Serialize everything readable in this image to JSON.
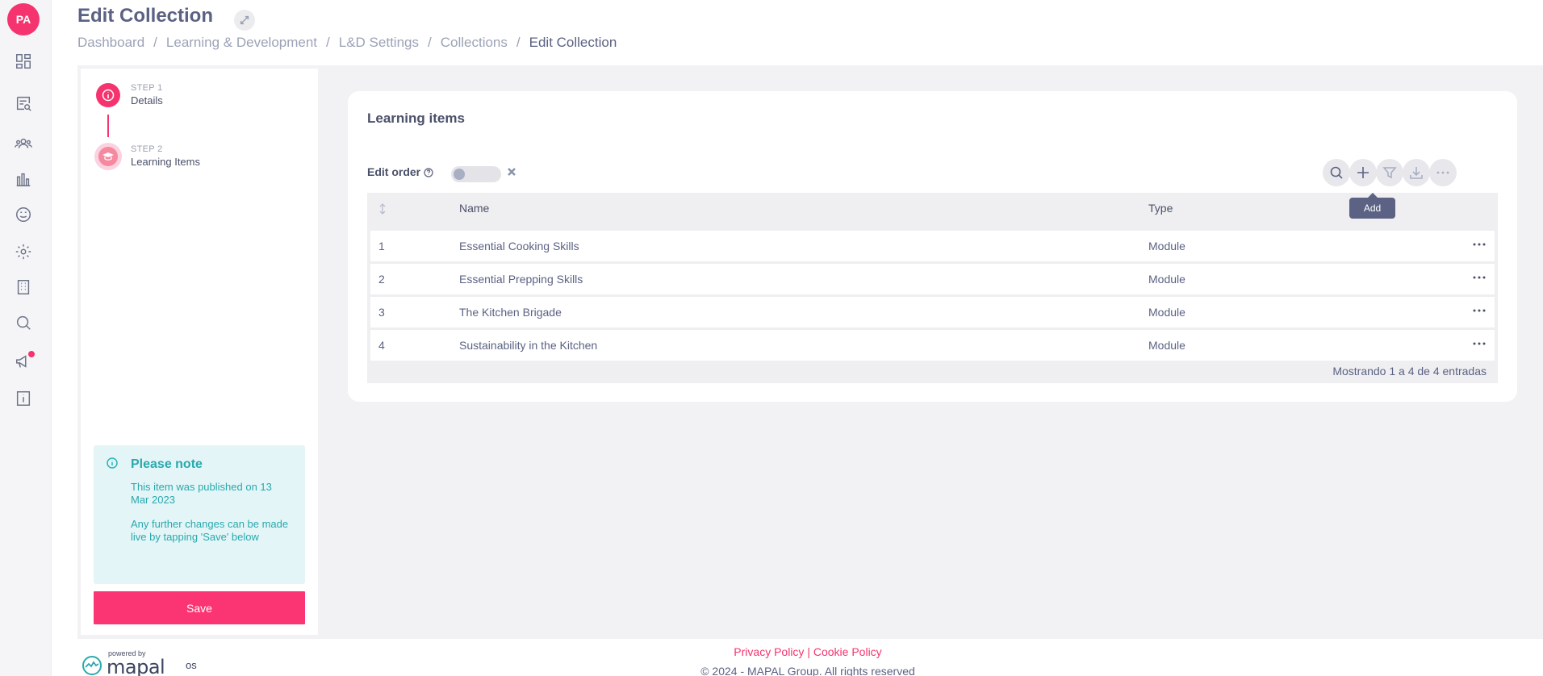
{
  "user": {
    "initials": "PA"
  },
  "rail": {
    "icons": [
      "dashboard-icon",
      "report-search-icon",
      "people-icon",
      "analytics-icon",
      "smiley-icon",
      "settings-icon",
      "building-icon",
      "search-icon",
      "megaphone-icon",
      "info-book-icon"
    ]
  },
  "header": {
    "title": "Edit Collection",
    "breadcrumb": [
      "Dashboard",
      "Learning & Development",
      "L&D Settings",
      "Collections",
      "Edit Collection"
    ],
    "separator": "/"
  },
  "stepper": {
    "steps": [
      {
        "number": "STEP 1",
        "label": "Details"
      },
      {
        "number": "STEP 2",
        "label": "Learning Items"
      }
    ],
    "note": {
      "title": "Please note",
      "line1": "This item was published on 13 Mar 2023",
      "line2": "Any further changes can be made live by tapping 'Save' below"
    },
    "save_label": "Save"
  },
  "card": {
    "title": "Learning items",
    "edit_order_label": "Edit order",
    "tooltip": "Add",
    "columns": {
      "sort": "↕",
      "name": "Name",
      "type": "Type"
    },
    "rows": [
      {
        "index": "1",
        "name": "Essential Cooking Skills",
        "type": "Module"
      },
      {
        "index": "2",
        "name": "Essential Prepping Skills",
        "type": "Module"
      },
      {
        "index": "3",
        "name": "The Kitchen Brigade",
        "type": "Module"
      },
      {
        "index": "4",
        "name": "Sustainability in the Kitchen",
        "type": "Module"
      }
    ],
    "footer": "Mostrando 1 a 4 de 4 entradas"
  },
  "footer": {
    "powered_by": "powered by",
    "brand": "mapal",
    "brand_suffix": "os",
    "privacy": "Privacy Policy",
    "divider": "|",
    "cookie": "Cookie Policy",
    "copyright": "© 2024 - MAPAL Group. All rights reserved"
  },
  "colors": {
    "accent": "#f5336f",
    "note_bg": "#e3f5f6",
    "note_text": "#2aa9ae",
    "title": "#5b6283"
  }
}
